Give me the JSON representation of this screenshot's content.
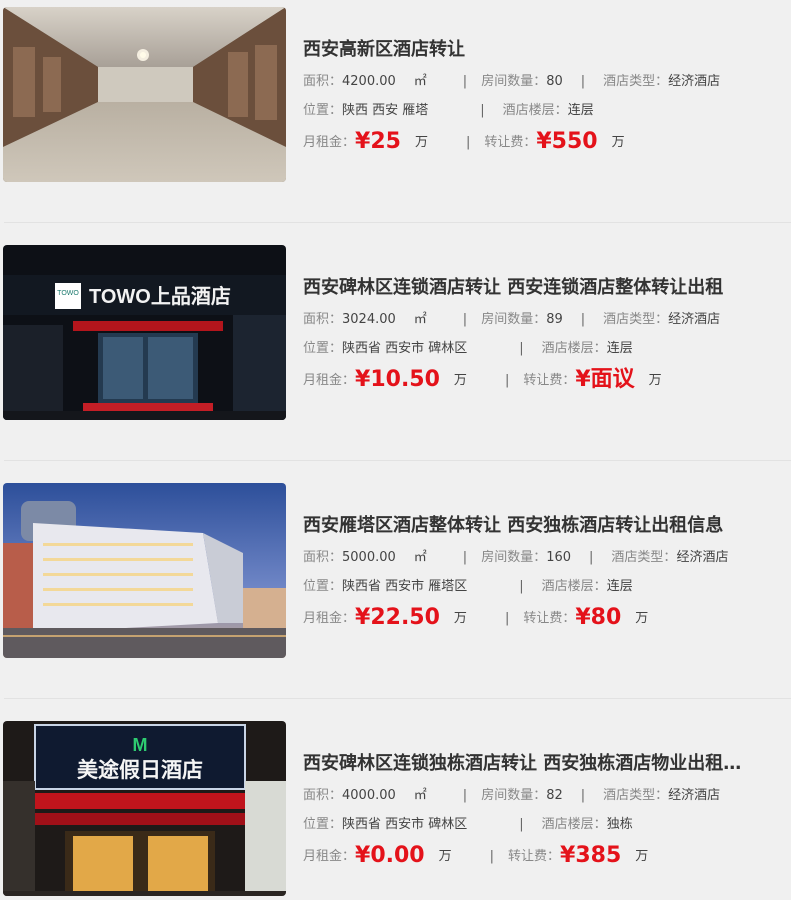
{
  "labels": {
    "area": "面积：",
    "rooms": "房间数量：",
    "type": "酒店类型：",
    "location": "位置：",
    "floor": "酒店楼层：",
    "rent": "月租金：",
    "fee": "转让费：",
    "sep": "|",
    "unit": "万",
    "sqm": "㎡"
  },
  "listings": [
    {
      "title": "西安高新区酒店转让",
      "area": "4200.00",
      "rooms": "80",
      "type": "经济酒店",
      "location": "陕西 西安 雁塔",
      "floor": "连层",
      "rent": "¥25",
      "fee": "¥550",
      "thumb_desc": "banquet-hall"
    },
    {
      "title": "西安碑林区连锁酒店转让 西安连锁酒店整体转让出租",
      "area": "3024.00",
      "rooms": "89",
      "type": "经济酒店",
      "location": "陕西省 西安市 碑林区",
      "floor": "连层",
      "rent": "¥10.50",
      "fee": "¥面议",
      "thumb_desc": "towo-storefront",
      "sign_text": "TOWO上品酒店",
      "sign_logo": "TOWO"
    },
    {
      "title": "西安雁塔区酒店整体转让 西安独栋酒店转让出租信息",
      "area": "5000.00",
      "rooms": "160",
      "type": "经济酒店",
      "location": "陕西省 西安市 雁塔区",
      "floor": "连层",
      "rent": "¥22.50",
      "fee": "¥80",
      "thumb_desc": "hotel-building-dusk"
    },
    {
      "title": "西安碑林区连锁独栋酒店转让 西安独栋酒店物业出租…",
      "area": "4000.00",
      "rooms": "82",
      "type": "经济酒店",
      "location": "陕西省 西安市 碑林区",
      "floor": "独栋",
      "rent": "¥0.00",
      "fee": "¥385",
      "thumb_desc": "metu-holiday-inn-storefront",
      "sign_text": "美途假日酒店"
    }
  ]
}
